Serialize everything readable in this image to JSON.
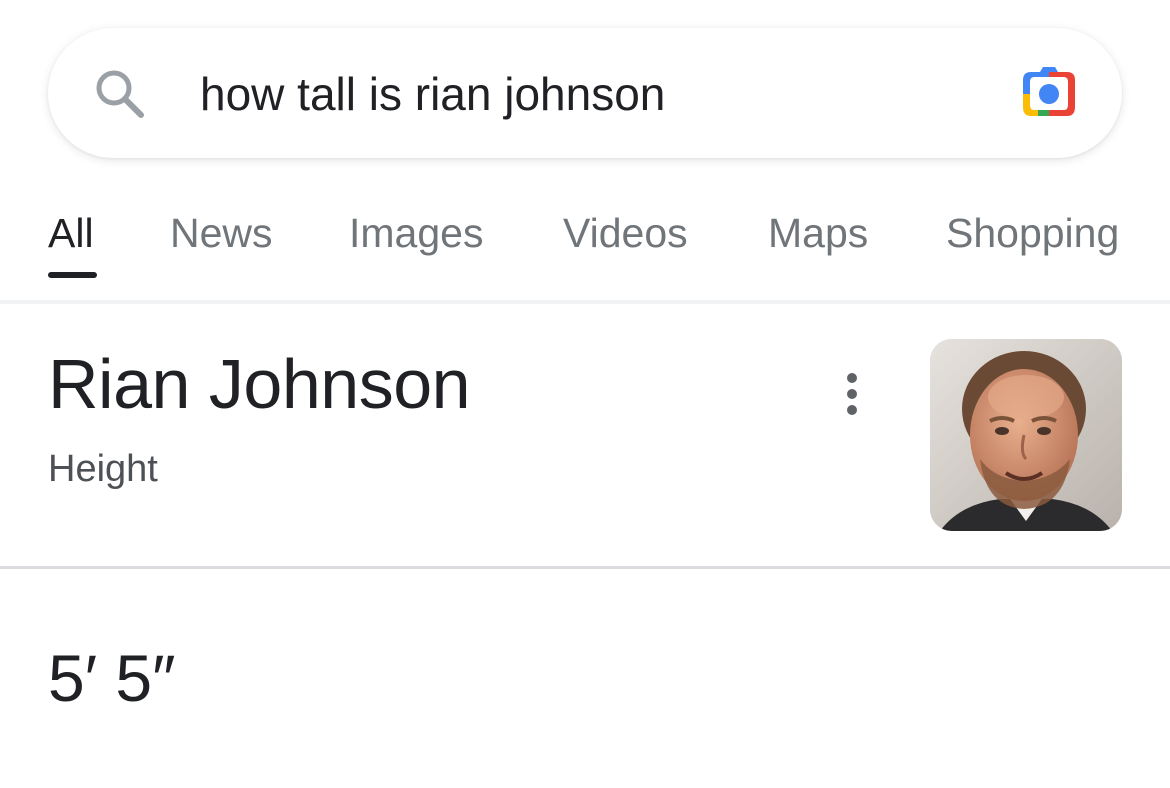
{
  "search": {
    "query": "how tall is rian johnson"
  },
  "icons": {
    "search": "search-icon",
    "lens": "google-lens-camera-icon",
    "more": "more-vert-icon"
  },
  "tabs": [
    {
      "label": "All",
      "active": true
    },
    {
      "label": "News",
      "active": false
    },
    {
      "label": "Images",
      "active": false
    },
    {
      "label": "Videos",
      "active": false
    },
    {
      "label": "Maps",
      "active": false
    },
    {
      "label": "Shopping",
      "active": false
    }
  ],
  "result": {
    "title": "Rian Johnson",
    "subtitle": "Height",
    "answer": "5′ 5″"
  },
  "colors": {
    "google_blue": "#4285f4",
    "google_red": "#ea4335",
    "google_yellow": "#fbbc04",
    "google_green": "#34a853",
    "text_primary": "#202124",
    "text_secondary": "#70757a"
  }
}
